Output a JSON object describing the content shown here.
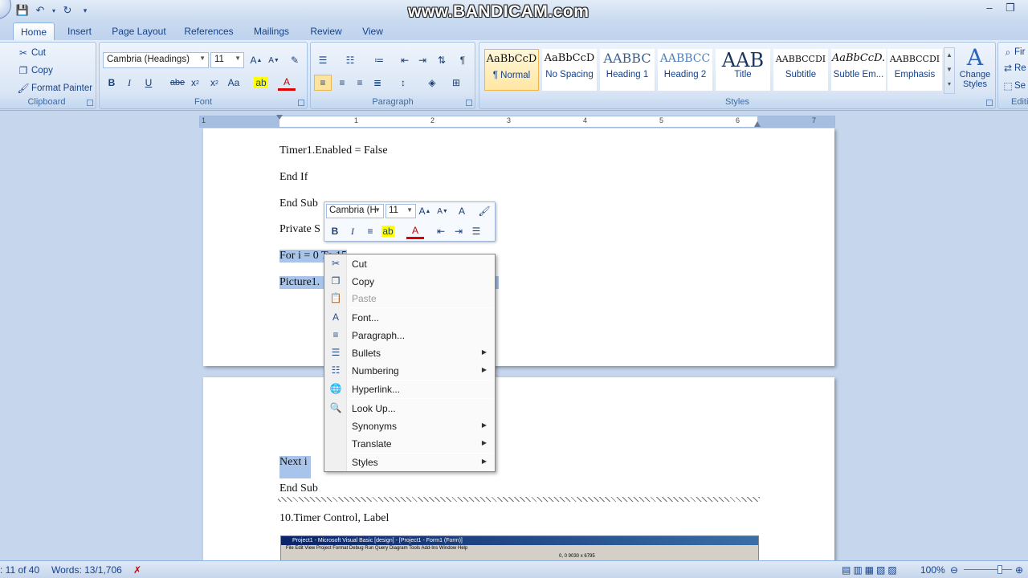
{
  "watermark": "www.BANDICAM.com",
  "tabs": [
    "Home",
    "Insert",
    "Page Layout",
    "References",
    "Mailings",
    "Review",
    "View"
  ],
  "clipboard": {
    "cut": "Cut",
    "copy": "Copy",
    "format_painter": "Format Painter",
    "label": "Clipboard"
  },
  "font": {
    "name": "Cambria (Headings)",
    "size": "11",
    "label": "Font"
  },
  "paragraph": {
    "label": "Paragraph"
  },
  "styles": {
    "label": "Styles",
    "items": [
      {
        "sample": "AaBbCcD",
        "name": "¶ Normal"
      },
      {
        "sample": "AaBbCcD",
        "name": "No Spacing"
      },
      {
        "sample": "AABBC",
        "name": "Heading 1"
      },
      {
        "sample": "AABBCC",
        "name": "Heading 2"
      },
      {
        "sample": "AAB",
        "name": "Title"
      },
      {
        "sample": "AABBCCDI",
        "name": "Subtitle"
      },
      {
        "sample": "AaBbCcD.",
        "name": "Subtle Em..."
      },
      {
        "sample": "AABBCCDI",
        "name": "Emphasis"
      }
    ],
    "change_styles": "Change Styles"
  },
  "editing": {
    "find": "Fir",
    "replace": "Re",
    "select": "Se",
    "label": "Editi"
  },
  "ruler_numbers": [
    "1",
    "1",
    "2",
    "3",
    "4",
    "5",
    "6",
    "7"
  ],
  "document": {
    "page1_lines": [
      "Timer1.Enabled = False",
      "End If",
      "End Sub",
      "Private S",
      "For i = 0 To 15",
      "Picture1."
    ],
    "page2_lines": [
      "Next i",
      "End Sub",
      "10.Timer Control, Label"
    ],
    "vb_title": "Project1 - Microsoft Visual Basic [design] - [Project1 - Form1 (Form)]",
    "vb_menu": "File  Edit  View  Project  Format  Debug  Run  Query  Diagram  Tools  Add-Ins  Window  Help",
    "vb_coords": "0, 0        9030 x 6795"
  },
  "minibar": {
    "font": "Cambria (H",
    "size": "11"
  },
  "context_menu": [
    {
      "label": "Cut",
      "icon": "scissors-icon",
      "glyph": "✂",
      "disabled": false,
      "sub": false
    },
    {
      "label": "Copy",
      "icon": "copy-icon",
      "glyph": "❐",
      "disabled": false,
      "sub": false
    },
    {
      "label": "Paste",
      "icon": "paste-icon",
      "glyph": "📋",
      "disabled": true,
      "sub": false,
      "sep_after": true
    },
    {
      "label": "Font...",
      "icon": "font-icon",
      "glyph": "A",
      "disabled": false,
      "sub": false
    },
    {
      "label": "Paragraph...",
      "icon": "paragraph-icon",
      "glyph": "≡",
      "disabled": false,
      "sub": false
    },
    {
      "label": "Bullets",
      "icon": "bullets-icon",
      "glyph": "☰",
      "disabled": false,
      "sub": true
    },
    {
      "label": "Numbering",
      "icon": "numbering-icon",
      "glyph": "☷",
      "disabled": false,
      "sub": true,
      "sep_after": true
    },
    {
      "label": "Hyperlink...",
      "icon": "hyperlink-icon",
      "glyph": "🌐",
      "disabled": false,
      "sub": false,
      "sep_after": true
    },
    {
      "label": "Look Up...",
      "icon": "lookup-icon",
      "glyph": "🔍",
      "disabled": false,
      "sub": false
    },
    {
      "label": "Synonyms",
      "icon": "",
      "glyph": "",
      "disabled": false,
      "sub": true
    },
    {
      "label": "Translate",
      "icon": "",
      "glyph": "",
      "disabled": false,
      "sub": true,
      "sep_after": true
    },
    {
      "label": "Styles",
      "icon": "",
      "glyph": "",
      "disabled": false,
      "sub": true
    }
  ],
  "status": {
    "page": ": 11 of 40",
    "words": "Words: 13/1,706",
    "zoom": "100%"
  }
}
